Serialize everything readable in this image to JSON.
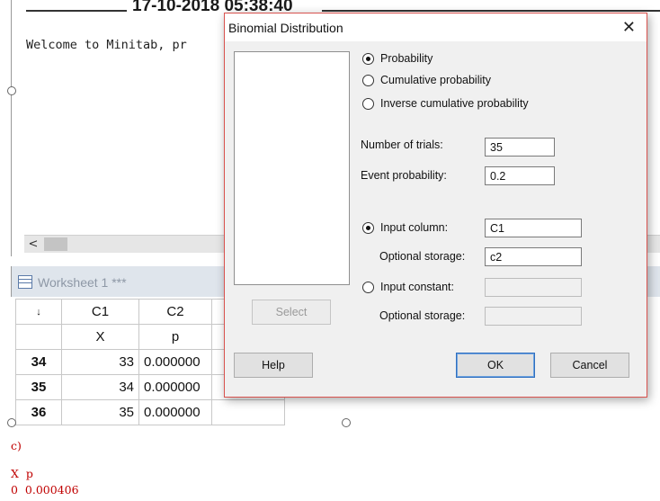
{
  "session": {
    "date_header": "17-10-2018 05:38:40",
    "welcome_text": "Welcome to Minitab, pr",
    "scroll_left_arrow": "<"
  },
  "worksheet": {
    "title": "Worksheet 1 ***",
    "sort_arrow": "↓",
    "columns": [
      "C1",
      "C2"
    ],
    "column_names": [
      "X",
      "p"
    ],
    "rows": [
      {
        "row": "34",
        "c1": "33",
        "c2": "0.000000"
      },
      {
        "row": "35",
        "c1": "34",
        "c2": "0.000000"
      },
      {
        "row": "36",
        "c1": "35",
        "c2": "0.000000"
      }
    ]
  },
  "output": {
    "part_label": "c)",
    "header": "X  p",
    "row": "0  0.000406"
  },
  "dialog": {
    "title": "Binomial Distribution",
    "close_glyph": "✕",
    "options": {
      "probability": "Probability",
      "cumulative": "Cumulative probability",
      "inverse": "Inverse cumulative probability",
      "selected": "probability"
    },
    "trials_label": "Number of trials:",
    "trials_value": "35",
    "event_label": "Event probability:",
    "event_value": "0.2",
    "input_column_label": "Input column:",
    "input_column_value": "C1",
    "optional_storage_label": "Optional storage:",
    "optional_storage_value": "c2",
    "input_constant_label": "Input constant:",
    "input_constant_value": "",
    "optional_storage2_label": "Optional storage:",
    "optional_storage2_value": "",
    "input_mode_selected": "column",
    "buttons": {
      "select": "Select",
      "help": "Help",
      "ok": "OK",
      "cancel": "Cancel"
    }
  }
}
